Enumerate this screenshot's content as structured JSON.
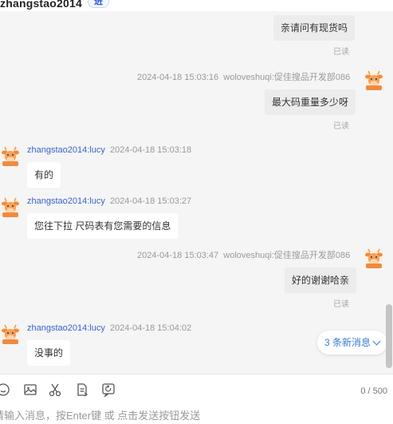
{
  "header": {
    "contact_name": "zhangstao2014",
    "status_badge": "进"
  },
  "messages": [
    {
      "side": "right",
      "sender": "",
      "timestamp": "",
      "text": "亲请问有现货吗",
      "read_status": "已读"
    },
    {
      "side": "right",
      "sender": "woloveshuqi:促佳搜品开发部086",
      "timestamp": "2024-04-18 15:03:16",
      "text": "最大码重量多少呀",
      "read_status": "已读"
    },
    {
      "side": "left",
      "sender": "zhangstao2014:lucy",
      "timestamp": "2024-04-18 15:03:18",
      "text": "有的",
      "read_status": ""
    },
    {
      "side": "left",
      "sender": "zhangstao2014:lucy",
      "timestamp": "2024-04-18 15:03:27",
      "text": "您往下拉 尺码表有您需要的信息",
      "read_status": ""
    },
    {
      "side": "right",
      "sender": "woloveshuqi:促佳搜品开发部086",
      "timestamp": "2024-04-18 15:03:47",
      "text": "好的谢谢哈亲",
      "read_status": "已读"
    },
    {
      "side": "left",
      "sender": "zhangstao2014:lucy",
      "timestamp": "2024-04-18 15:04:02",
      "text": "没事的",
      "read_status": ""
    }
  ],
  "new_messages_label": "3 条新消息",
  "toolbar": {
    "icons": [
      "emoji-icon",
      "image-icon",
      "scissors-icon",
      "document-icon",
      "refresh-message-icon"
    ],
    "char_counter": "0 / 500"
  },
  "input": {
    "value": "",
    "placeholder": "请输入消息，按Enter键 或 点击发送按钮发送"
  },
  "colors": {
    "chat_background": "#f5f5f5",
    "right_bubble": "#ececec",
    "left_bubble": "#ffffff",
    "sender_link": "#3a63c9",
    "new_message_text": "#3a7bd5"
  }
}
